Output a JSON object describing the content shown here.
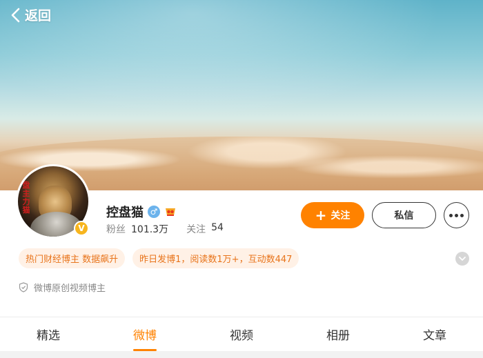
{
  "nav": {
    "back_label": "返回"
  },
  "profile": {
    "name": "控盘猫",
    "avatar_stamp": "盘主力猫",
    "verified_mark": "V",
    "gender_symbol": "♂",
    "stats": {
      "fans_label": "粉丝",
      "fans_value": "101.3万",
      "following_label": "关注",
      "following_value": "54"
    }
  },
  "actions": {
    "follow_label": "关注",
    "message_label": "私信"
  },
  "tags": [
    {
      "text": "热门财经博主 数据飙升"
    },
    {
      "text": "昨日发博1，阅读数1万+，互动数447"
    }
  ],
  "intro": {
    "text": "微博原创视频博主"
  },
  "tabs": [
    {
      "label": "精选"
    },
    {
      "label": "微博"
    },
    {
      "label": "视频"
    },
    {
      "label": "相册"
    },
    {
      "label": "文章"
    }
  ],
  "active_tab_index": 1,
  "colors": {
    "accent": "#ff8200",
    "tag_bg": "#fff1e6",
    "tag_text": "#e8741b",
    "verified": "#f7b51e",
    "gender": "#6cb3ec"
  }
}
